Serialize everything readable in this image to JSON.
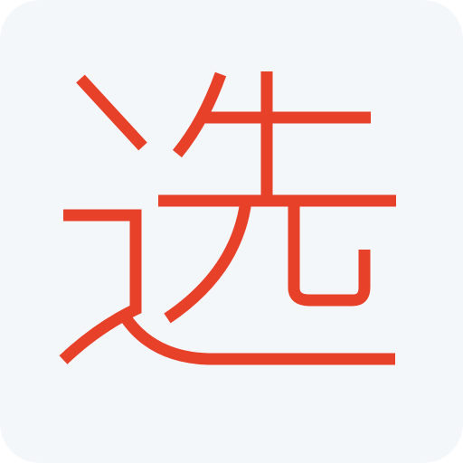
{
  "app_icon": {
    "name": "选-app-icon",
    "glyph": "选",
    "colors": {
      "background": "#f4f7fa",
      "glyph": "#e8412a"
    }
  }
}
